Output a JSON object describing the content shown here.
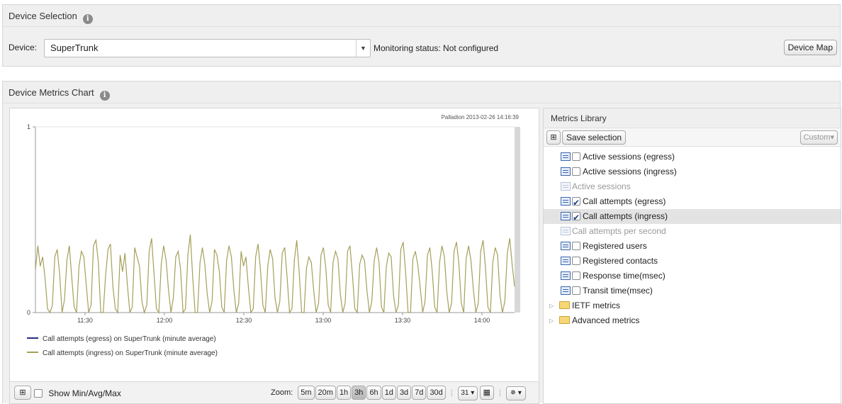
{
  "device_panel": {
    "title": "Device Selection",
    "info_icon": "i",
    "device_label": "Device:",
    "device_value": "SuperTrunk",
    "monitoring_status": "Monitoring status: Not configured",
    "device_map_label": "Device Map"
  },
  "metrics_panel": {
    "title": "Device Metrics Chart",
    "info_icon": "i"
  },
  "chart": {
    "timestamp": "Palladion 2013-02-26 14:16:39",
    "legend": [
      {
        "label": "Call attempts (egress) on SuperTrunk (minute average)",
        "color": "#2b2d7a"
      },
      {
        "label": "Call attempts (ingress) on SuperTrunk (minute average)",
        "color": "#a4a05a"
      }
    ],
    "toolbar": {
      "show_min_avg_max": "Show Min/Avg/Max",
      "zoom_label": "Zoom:",
      "zoom_options": [
        "5m",
        "20m",
        "1h",
        "3h",
        "6h",
        "1d",
        "3d",
        "7d",
        "30d"
      ],
      "zoom_selected": "3h",
      "calendar_icon_text": "31"
    }
  },
  "chart_data": {
    "type": "line",
    "y_ticks": [
      "0",
      "1"
    ],
    "ylim": [
      0,
      1
    ],
    "x_ticks": [
      "11:30",
      "12:00",
      "12:30",
      "13:00",
      "13:30",
      "14:00"
    ],
    "series": [
      {
        "name": "Call attempts (egress) on SuperTrunk (minute average)",
        "color": "#2b2d7a",
        "values": []
      },
      {
        "name": "Call attempts (ingress) on SuperTrunk (minute average)",
        "color": "#a4a05a",
        "values": [
          0.23,
          0.36,
          0.25,
          0.3,
          0.18,
          0.02,
          0.0,
          0.04,
          0.3,
          0.34,
          0.21,
          0.0,
          0.07,
          0.28,
          0.36,
          0.19,
          0.03,
          0.0,
          0.25,
          0.33,
          0.3,
          0.15,
          0.0,
          0.04,
          0.36,
          0.39,
          0.27,
          0.0,
          0.0,
          0.2,
          0.34,
          0.37,
          0.14,
          0.02,
          0.0,
          0.31,
          0.22,
          0.32,
          0.15,
          0.0,
          0.03,
          0.35,
          0.3,
          0.25,
          0.06,
          0.0,
          0.04,
          0.33,
          0.4,
          0.21,
          0.02,
          0.0,
          0.26,
          0.36,
          0.28,
          0.12,
          0.0,
          0.08,
          0.3,
          0.33,
          0.23,
          0.0,
          0.02,
          0.31,
          0.42,
          0.19,
          0.0,
          0.0,
          0.27,
          0.35,
          0.26,
          0.1,
          0.0,
          0.06,
          0.34,
          0.31,
          0.22,
          0.03,
          0.0,
          0.28,
          0.36,
          0.3,
          0.12,
          0.0,
          0.05,
          0.33,
          0.25,
          0.3,
          0.14,
          0.0,
          0.02,
          0.3,
          0.37,
          0.23,
          0.04,
          0.0,
          0.25,
          0.34,
          0.29,
          0.08,
          0.0,
          0.06,
          0.32,
          0.35,
          0.19,
          0.0,
          0.02,
          0.28,
          0.39,
          0.22,
          0.0,
          0.0,
          0.24,
          0.3,
          0.27,
          0.12,
          0.0,
          0.05,
          0.31,
          0.35,
          0.24,
          0.04,
          0.0,
          0.27,
          0.33,
          0.29,
          0.1,
          0.0,
          0.05,
          0.33,
          0.36,
          0.2,
          0.02,
          0.0,
          0.26,
          0.31,
          0.28,
          0.12,
          0.0,
          0.06,
          0.28,
          0.35,
          0.27,
          0.03,
          0.0,
          0.25,
          0.32,
          0.3,
          0.09,
          0.0,
          0.04,
          0.34,
          0.38,
          0.21,
          0.0,
          0.0,
          0.29,
          0.33,
          0.26,
          0.14,
          0.0,
          0.06,
          0.31,
          0.35,
          0.22,
          0.03,
          0.0,
          0.27,
          0.36,
          0.3,
          0.11,
          0.0,
          0.05,
          0.33,
          0.38,
          0.26,
          0.05,
          0.0,
          0.29,
          0.36,
          0.28,
          0.12,
          0.0,
          0.05,
          0.33,
          0.39,
          0.24,
          0.03,
          0.0,
          0.27,
          0.35,
          0.31,
          0.09,
          0.0,
          0.06,
          0.32,
          0.4,
          0.26,
          0.14
        ]
      }
    ]
  },
  "library": {
    "title": "Metrics Library",
    "save_selection": "Save selection",
    "custom_label": "Custom",
    "items": [
      {
        "label": "Active sessions (egress)",
        "checked": false,
        "enabled": true
      },
      {
        "label": "Active sessions (ingress)",
        "checked": false,
        "enabled": true
      },
      {
        "label": "Active sessions",
        "checked": false,
        "enabled": false
      },
      {
        "label": "Call attempts (egress)",
        "checked": true,
        "enabled": true
      },
      {
        "label": "Call attempts (ingress)",
        "checked": true,
        "enabled": true,
        "selected": true
      },
      {
        "label": "Call attempts per second",
        "checked": false,
        "enabled": false
      },
      {
        "label": "Registered users",
        "checked": false,
        "enabled": true
      },
      {
        "label": "Registered contacts",
        "checked": false,
        "enabled": true
      },
      {
        "label": "Response time(msec)",
        "checked": false,
        "enabled": true
      },
      {
        "label": "Transit time(msec)",
        "checked": false,
        "enabled": true
      }
    ],
    "folders": [
      {
        "label": "IETF metrics"
      },
      {
        "label": "Advanced metrics"
      }
    ]
  }
}
